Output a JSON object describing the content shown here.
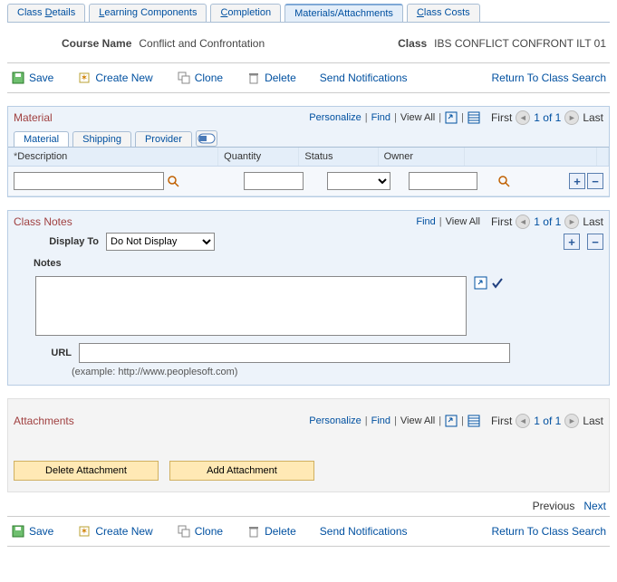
{
  "tabs": {
    "details": "Class Details",
    "components": "Learning Components",
    "completion": "Completion",
    "materials": "Materials/Attachments",
    "costs": "Class Costs"
  },
  "header": {
    "course_name_label": "Course Name",
    "course_name": "Conflict and Confrontation",
    "class_label": "Class",
    "class_value": "IBS CONFLICT CONFRONT ILT 01"
  },
  "toolbar": {
    "save": "Save",
    "create_new": "Create New",
    "clone": "Clone",
    "delete": "Delete",
    "send_notifications": "Send Notifications",
    "return_search": "Return To Class Search"
  },
  "material": {
    "title": "Material",
    "personalize": "Personalize",
    "find": "Find",
    "view_all": "View All",
    "first": "First",
    "range": "1 of 1",
    "last": "Last",
    "subtabs": {
      "material": "Material",
      "shipping": "Shipping",
      "provider": "Provider"
    },
    "columns": {
      "description": "Description",
      "quantity": "Quantity",
      "status": "Status",
      "owner": "Owner"
    },
    "row": {
      "description": "",
      "quantity": "",
      "status_options": [
        ""
      ],
      "owner": ""
    }
  },
  "class_notes": {
    "title": "Class Notes",
    "find": "Find",
    "view_all": "View All",
    "first": "First",
    "range": "1 of 1",
    "last": "Last",
    "display_to_label": "Display To",
    "display_to_value": "Do Not Display",
    "notes_label": "Notes",
    "notes_value": "",
    "url_label": "URL",
    "url_value": "",
    "url_hint": "(example: http://www.peoplesoft.com)"
  },
  "attachments": {
    "title": "Attachments",
    "personalize": "Personalize",
    "find": "Find",
    "view_all": "View All",
    "first": "First",
    "range": "1 of 1",
    "last": "Last",
    "delete_btn": "Delete Attachment",
    "add_btn": "Add Attachment"
  },
  "pager": {
    "previous": "Previous",
    "next": "Next"
  }
}
